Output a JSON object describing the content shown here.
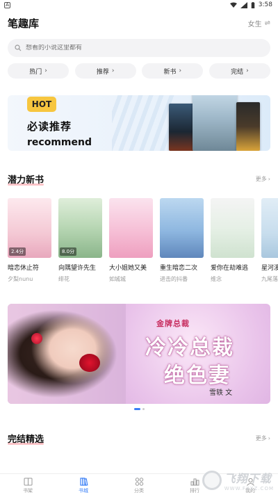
{
  "status_bar": {
    "left_icon": "A",
    "time": "3:58"
  },
  "header": {
    "title": "笔趣库",
    "gender": "女生",
    "swap_icon": "⇌"
  },
  "search": {
    "placeholder": "想看的小说这里都有"
  },
  "pills": [
    {
      "label": "热门"
    },
    {
      "label": "推荐"
    },
    {
      "label": "新书"
    },
    {
      "label": "完结"
    }
  ],
  "recommend_banner": {
    "badge": "HOT",
    "title": "必读推荐",
    "subtitle": "recommend"
  },
  "section_new": {
    "title": "潜力新书",
    "more": "更多"
  },
  "books": [
    {
      "title": "暗恋休止符",
      "author": "夕梨nunu",
      "badge": "2.4分"
    },
    {
      "title": "向隅望许先生",
      "author": "绯花",
      "badge": "8.0分"
    },
    {
      "title": "大小姐她又美",
      "author": "如城城",
      "badge": ""
    },
    {
      "title": "重生暗恋二次",
      "author": "进击的抖番",
      "badge": ""
    },
    {
      "title": "爱你在劫难逃",
      "author": "维念",
      "badge": ""
    },
    {
      "title": "星河漫",
      "author": "九尾落",
      "badge": ""
    }
  ],
  "big_banner": {
    "tag": "金牌总裁",
    "title_line1": "冷冷总裁",
    "title_line2": "绝色妻",
    "author": "雪轶 文"
  },
  "section_finished": {
    "title": "完结精选",
    "more": "更多"
  },
  "tabbar": {
    "tabs": [
      {
        "label": "书架",
        "icon": "book-icon"
      },
      {
        "label": "书城",
        "icon": "bookstore-icon"
      },
      {
        "label": "分类",
        "icon": "grid-icon"
      },
      {
        "label": "排行",
        "icon": "rank-icon"
      },
      {
        "label": "我的",
        "icon": "user-icon"
      }
    ],
    "active_index": 1
  },
  "watermark": {
    "main": "飞翔下载",
    "sub": "WWW.FXXZ.COM"
  },
  "colors": {
    "accent": "#3a7ff6",
    "hot": "#f7c63f"
  }
}
